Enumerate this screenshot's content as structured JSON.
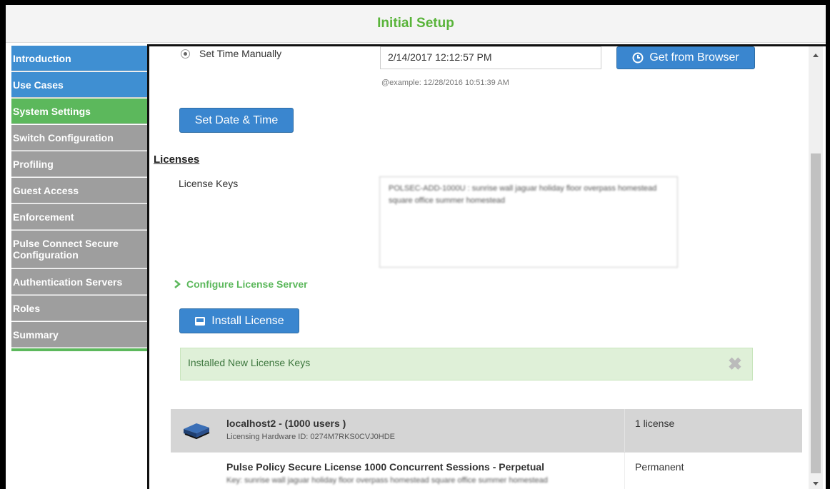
{
  "header": {
    "title": "Initial Setup"
  },
  "sidebar": {
    "items": [
      {
        "label": "Introduction",
        "state": "done"
      },
      {
        "label": "Use Cases",
        "state": "done"
      },
      {
        "label": "System Settings",
        "state": "active"
      },
      {
        "label": "Switch Configuration",
        "state": "pending"
      },
      {
        "label": "Profiling",
        "state": "pending"
      },
      {
        "label": "Guest Access",
        "state": "pending"
      },
      {
        "label": "Enforcement",
        "state": "pending"
      },
      {
        "label": "Pulse Connect Secure Configuration",
        "state": "pending"
      },
      {
        "label": "Authentication Servers",
        "state": "pending"
      },
      {
        "label": "Roles",
        "state": "pending"
      },
      {
        "label": "Summary",
        "state": "pending"
      }
    ]
  },
  "time": {
    "radio_label": "Set Time Manually",
    "value": "2/14/2017 12:12:57 PM",
    "hint": "@example: 12/28/2016 10:51:39 AM",
    "browser_button": "Get from Browser",
    "set_button": "Set Date & Time"
  },
  "licenses": {
    "heading": "Licenses",
    "keys_label": "License Keys",
    "keys_value": "POLSEC-ADD-1000U : sunrise wall jaguar holiday floor overpass homestead square office summer homestead",
    "configure_link": "Configure License Server",
    "install_button": "Install License",
    "alert": "Installed New License Keys"
  },
  "license_table": {
    "host_title": "localhost2 - (1000 users )",
    "hardware_id": "Licensing Hardware ID: 0274M7RKS0CVJ0HDE",
    "license_count": "1 license",
    "product_title": "Pulse Policy Secure License 1000 Concurrent Sessions - Perpetual",
    "product_key": "Key: sunrise wall jaguar holiday floor overpass homestead square office summer homestead",
    "term": "Permanent"
  },
  "colors": {
    "accent_blue": "#3f8fd2",
    "active_green": "#5cb85c",
    "inactive_grey": "#9e9e9e",
    "title_green": "#59b43a"
  }
}
